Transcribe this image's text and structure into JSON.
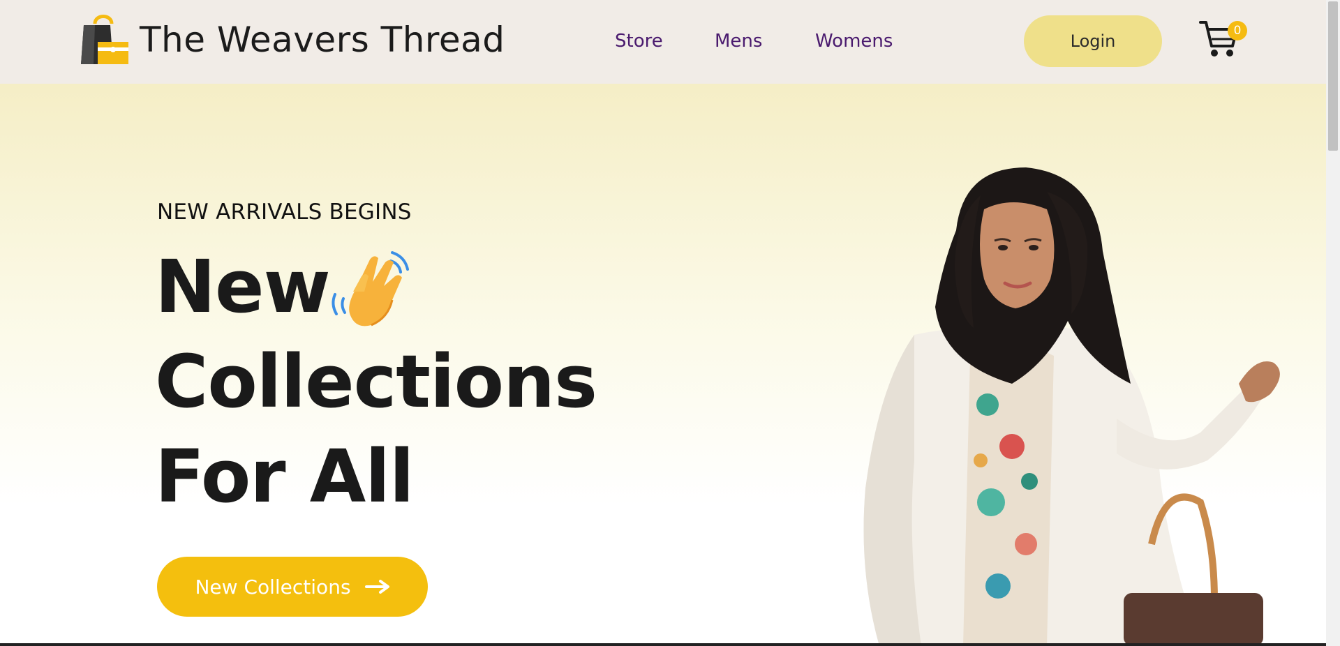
{
  "header": {
    "brand": "The Weavers Thread",
    "nav": [
      "Store",
      "Mens",
      "Womens"
    ],
    "login_label": "Login",
    "cart_count": "0",
    "icons": {
      "logo": "shopping-bag-icon",
      "cart": "cart-icon"
    }
  },
  "hero": {
    "eyebrow": "NEW ARRIVALS BEGINS",
    "headline": [
      "New",
      "Collections",
      "For All"
    ],
    "cta_label": "New Collections",
    "icons": {
      "wave": "waving-hand-icon",
      "cta": "arrow-right-icon"
    }
  },
  "colors": {
    "header_bg": "#f1ece7",
    "nav_text": "#4a1a6e",
    "login_bg": "#efe08a",
    "accent": "#f4bf0e",
    "hero_top": "#f5eec6"
  }
}
